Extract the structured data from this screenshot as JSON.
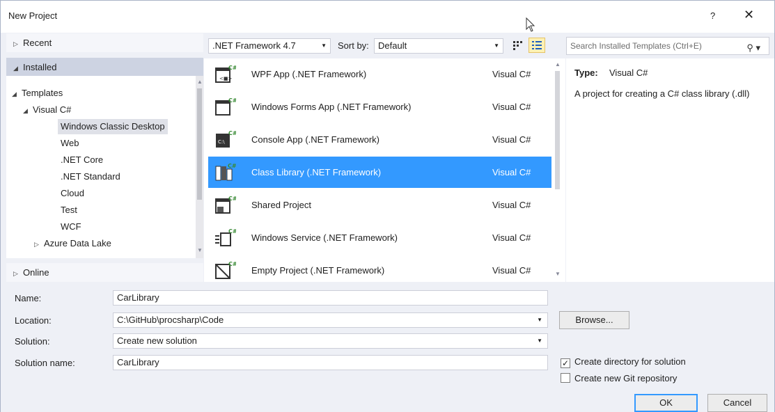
{
  "window": {
    "title": "New Project",
    "help": "?",
    "close": "✕"
  },
  "left": {
    "recent": "Recent",
    "installed": "Installed",
    "templates": "Templates",
    "visual_cs": "Visual C#",
    "children": [
      "Windows Classic Desktop",
      "Web",
      ".NET Core",
      ".NET Standard",
      "Cloud",
      "Test",
      "WCF"
    ],
    "azure": "Azure Data Lake",
    "online": "Online"
  },
  "toolbar": {
    "framework": ".NET Framework 4.7",
    "sort_label": "Sort by:",
    "sort_value": "Default"
  },
  "templates": [
    {
      "name": "WPF App (.NET Framework)",
      "lang": "Visual C#",
      "icon": "wpf-app-icon"
    },
    {
      "name": "Windows Forms App (.NET Framework)",
      "lang": "Visual C#",
      "icon": "windows-forms-icon"
    },
    {
      "name": "Console App (.NET Framework)",
      "lang": "Visual C#",
      "icon": "console-app-icon"
    },
    {
      "name": "Class Library (.NET Framework)",
      "lang": "Visual C#",
      "icon": "class-library-icon"
    },
    {
      "name": "Shared Project",
      "lang": "Visual C#",
      "icon": "shared-project-icon"
    },
    {
      "name": "Windows Service (.NET Framework)",
      "lang": "Visual C#",
      "icon": "windows-service-icon"
    },
    {
      "name": "Empty Project (.NET Framework)",
      "lang": "Visual C#",
      "icon": "empty-project-icon"
    }
  ],
  "search": {
    "placeholder": "Search Installed Templates (Ctrl+E)"
  },
  "info": {
    "type_label": "Type:",
    "type_value": "Visual C#",
    "description": "A project for creating a C# class library (.dll)"
  },
  "form": {
    "name_label": "Name:",
    "name_value": "CarLibrary",
    "location_label": "Location:",
    "location_value": "C:\\GitHub\\procsharp\\Code",
    "solution_label": "Solution:",
    "solution_value": "Create new solution",
    "solution_name_label": "Solution name:",
    "solution_name_value": "CarLibrary",
    "browse": "Browse...",
    "create_dir": "Create directory for solution",
    "create_dir_checked": true,
    "create_git": "Create new Git repository",
    "create_git_checked": false,
    "ok": "OK",
    "cancel": "Cancel"
  },
  "colors": {
    "selection": "#3399ff",
    "accent": "#1e1e1e"
  }
}
